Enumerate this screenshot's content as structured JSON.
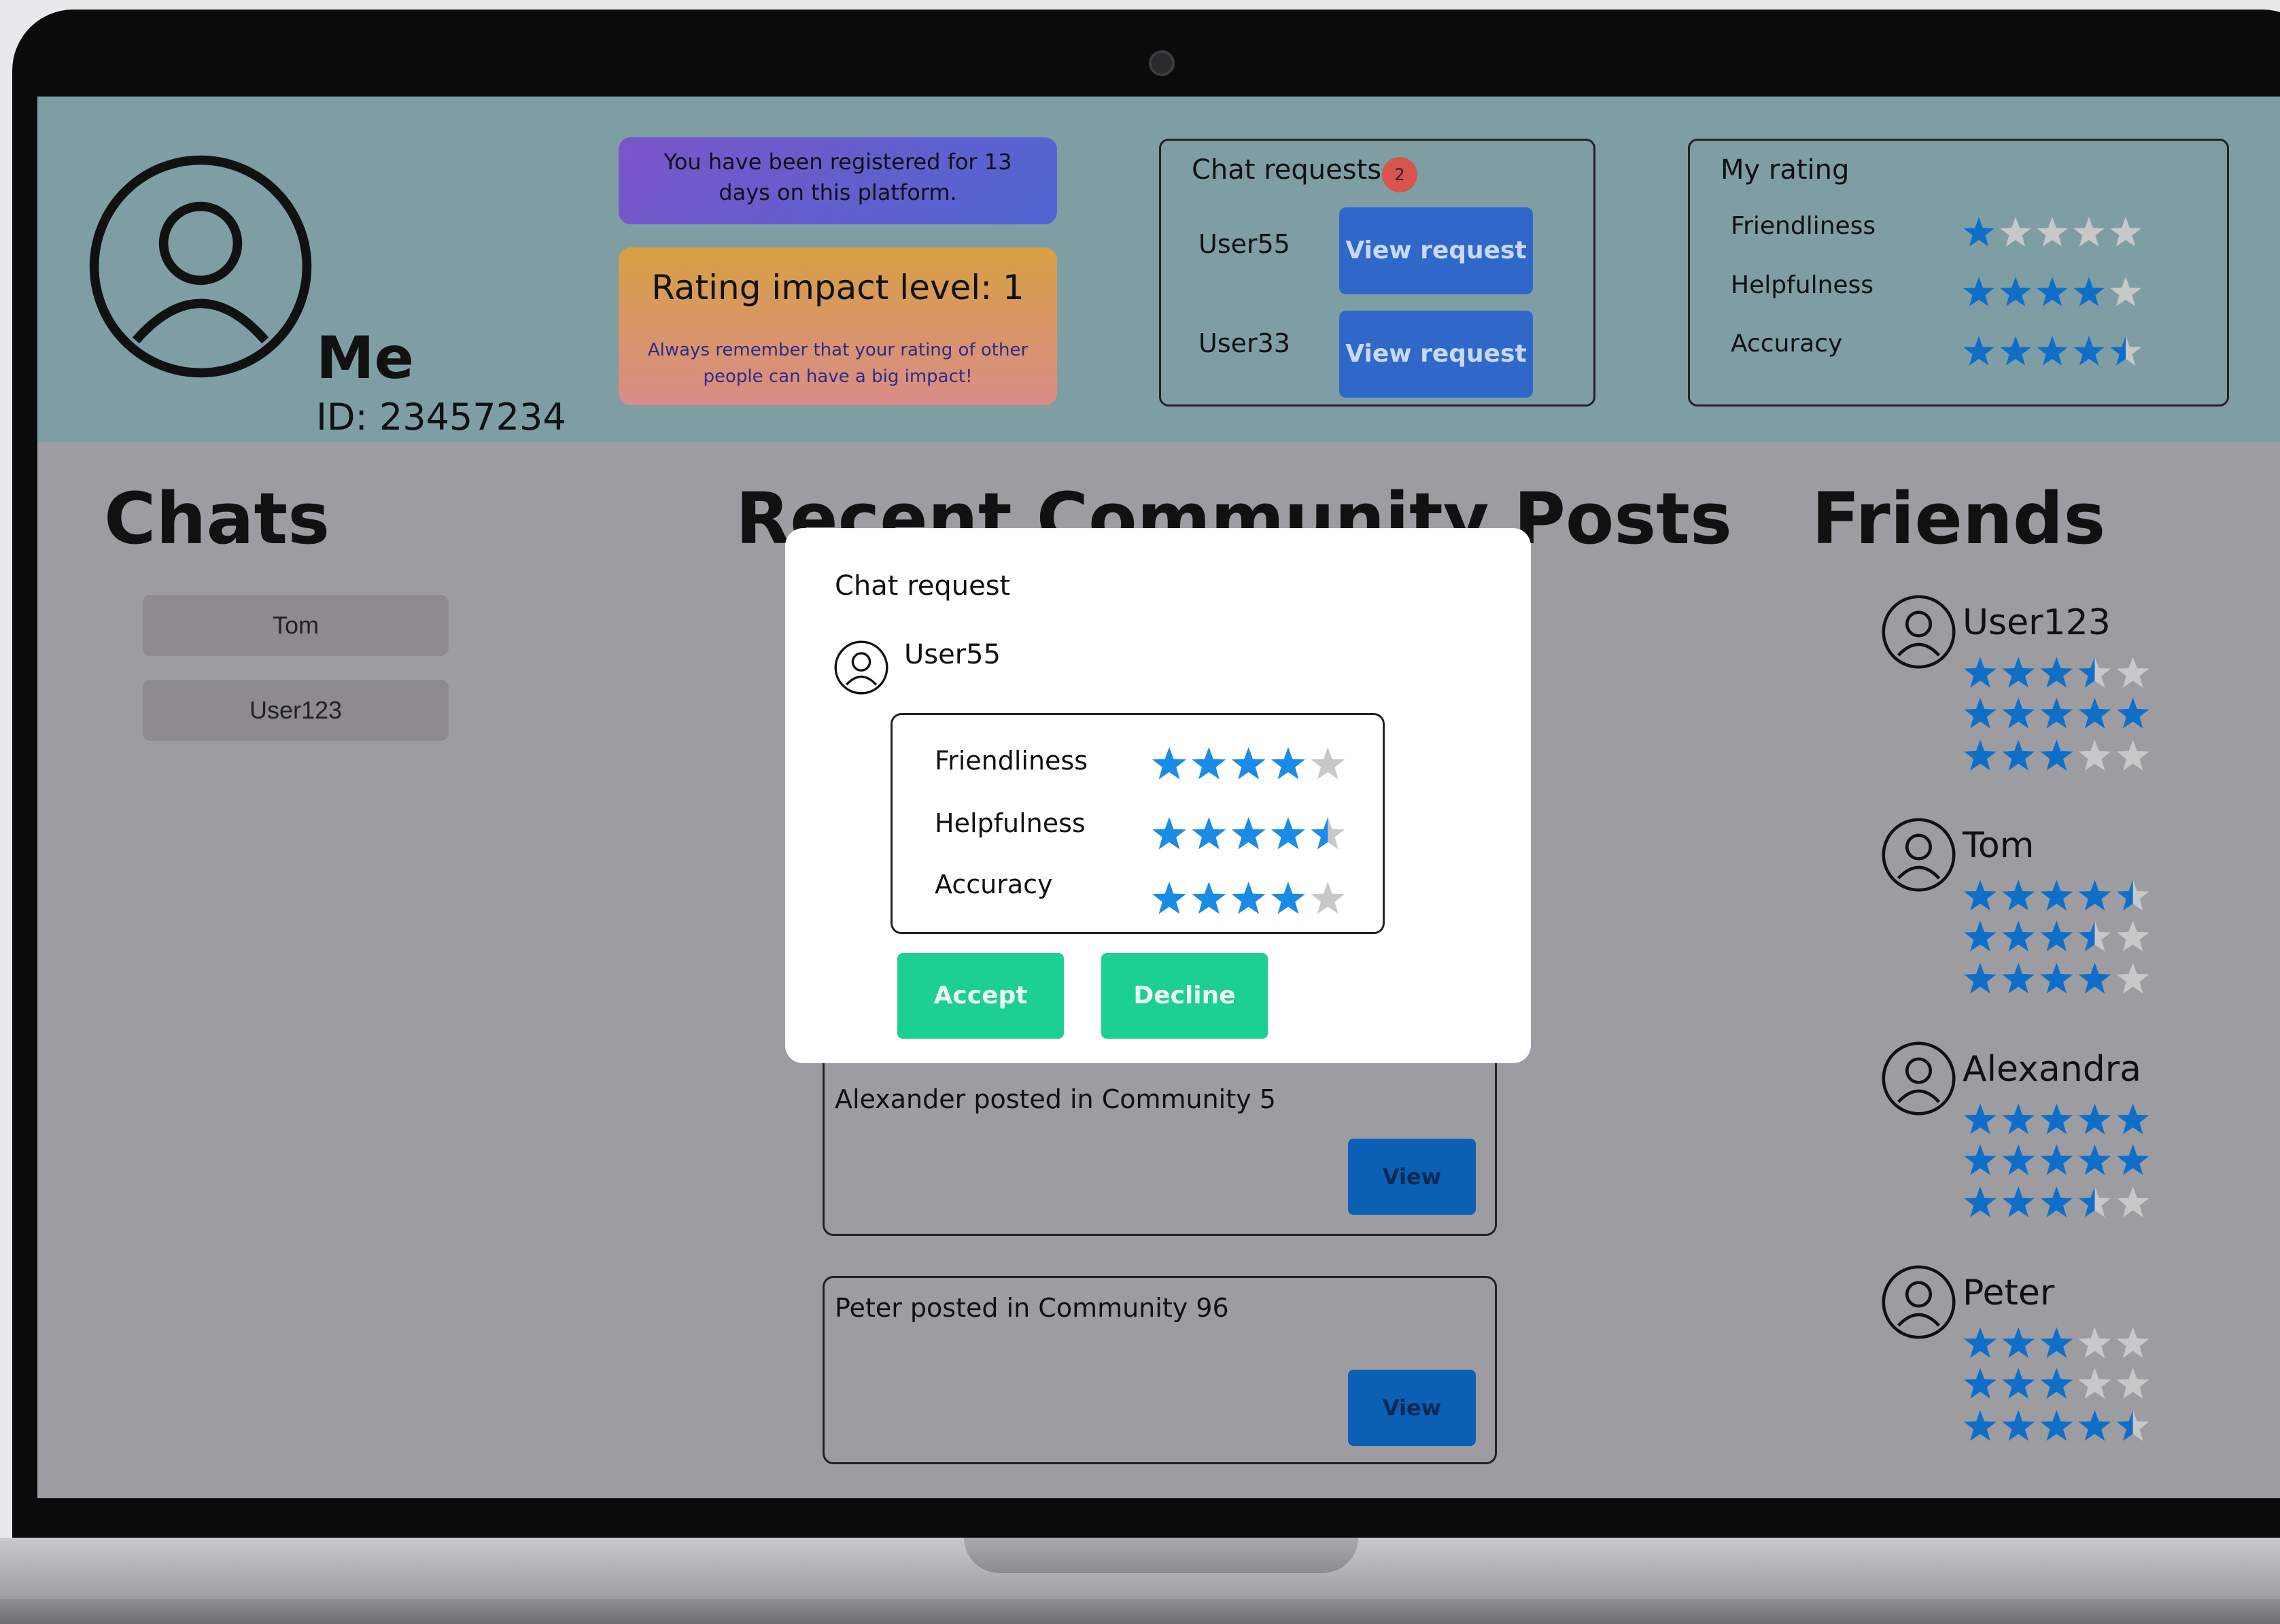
{
  "profile": {
    "name": "Me",
    "id": "ID: 23457234"
  },
  "registered_notice": "You have been registered for 13 days on this platform.",
  "impact": {
    "title": "Rating impact level: 1",
    "subtitle": "Always remember that your rating of other people can have a big impact!"
  },
  "chat_requests": {
    "title": "Chat requests",
    "count": "2",
    "items": [
      {
        "user": "User55",
        "button": "View request"
      },
      {
        "user": "User33",
        "button": "View request"
      }
    ]
  },
  "my_rating": {
    "title": "My rating",
    "rows": [
      {
        "label": "Friendliness",
        "stars": 1
      },
      {
        "label": "Helpfulness",
        "stars": 4
      },
      {
        "label": "Accuracy",
        "stars": 4.5
      }
    ]
  },
  "chats": {
    "title": "Chats",
    "items": [
      "Tom",
      "User123"
    ]
  },
  "posts": {
    "title": "Recent Community Posts",
    "items": [
      {
        "text": "Alexander  posted in Community 5",
        "button": "View"
      },
      {
        "text": "Peter posted in Community 96",
        "button": "View"
      }
    ]
  },
  "friends": {
    "title": "Friends",
    "items": [
      {
        "name": "User123",
        "ratings": [
          3.5,
          5,
          3
        ]
      },
      {
        "name": "Tom",
        "ratings": [
          4.5,
          3.5,
          4
        ]
      },
      {
        "name": "Alexandra",
        "ratings": [
          5,
          5,
          3.5
        ]
      },
      {
        "name": "Peter",
        "ratings": [
          3,
          3,
          4.5
        ]
      }
    ]
  },
  "modal": {
    "title": "Chat request",
    "user": "User55",
    "rows": [
      {
        "label": "Friendliness",
        "stars": 4
      },
      {
        "label": "Helpfulness",
        "stars": 4.5
      },
      {
        "label": "Accuracy",
        "stars": 4
      }
    ],
    "accept": "Accept",
    "decline": "Decline"
  },
  "colors": {
    "star_blue": "#0f6fc8",
    "star_modal": "#1a8be6",
    "star_empty": "#c8c8c8",
    "accent_green": "#1ccf93",
    "header_bg": "#7e9ea4"
  }
}
